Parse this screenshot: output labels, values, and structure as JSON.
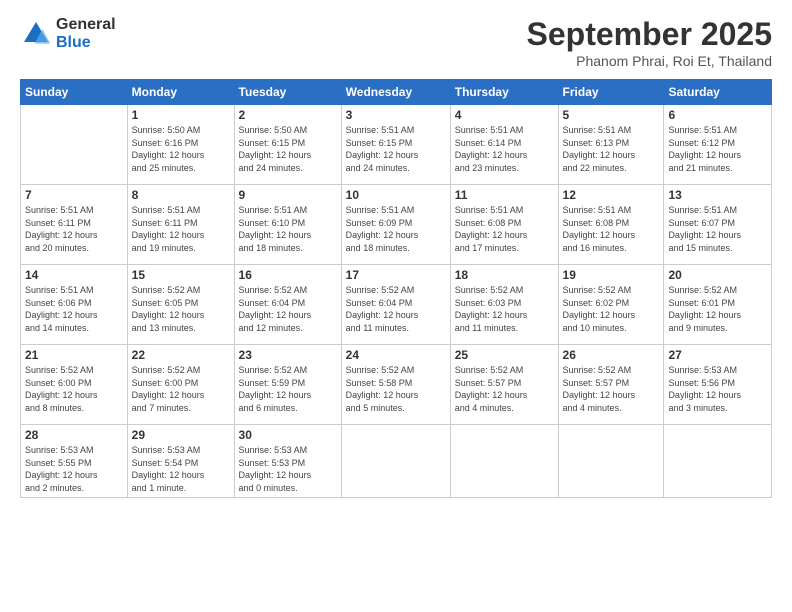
{
  "logo": {
    "general": "General",
    "blue": "Blue"
  },
  "header": {
    "month": "September 2025",
    "location": "Phanom Phrai, Roi Et, Thailand"
  },
  "weekdays": [
    "Sunday",
    "Monday",
    "Tuesday",
    "Wednesday",
    "Thursday",
    "Friday",
    "Saturday"
  ],
  "weeks": [
    [
      {
        "day": "",
        "info": ""
      },
      {
        "day": "1",
        "info": "Sunrise: 5:50 AM\nSunset: 6:16 PM\nDaylight: 12 hours\nand 25 minutes."
      },
      {
        "day": "2",
        "info": "Sunrise: 5:50 AM\nSunset: 6:15 PM\nDaylight: 12 hours\nand 24 minutes."
      },
      {
        "day": "3",
        "info": "Sunrise: 5:51 AM\nSunset: 6:15 PM\nDaylight: 12 hours\nand 24 minutes."
      },
      {
        "day": "4",
        "info": "Sunrise: 5:51 AM\nSunset: 6:14 PM\nDaylight: 12 hours\nand 23 minutes."
      },
      {
        "day": "5",
        "info": "Sunrise: 5:51 AM\nSunset: 6:13 PM\nDaylight: 12 hours\nand 22 minutes."
      },
      {
        "day": "6",
        "info": "Sunrise: 5:51 AM\nSunset: 6:12 PM\nDaylight: 12 hours\nand 21 minutes."
      }
    ],
    [
      {
        "day": "7",
        "info": "Sunrise: 5:51 AM\nSunset: 6:11 PM\nDaylight: 12 hours\nand 20 minutes."
      },
      {
        "day": "8",
        "info": "Sunrise: 5:51 AM\nSunset: 6:11 PM\nDaylight: 12 hours\nand 19 minutes."
      },
      {
        "day": "9",
        "info": "Sunrise: 5:51 AM\nSunset: 6:10 PM\nDaylight: 12 hours\nand 18 minutes."
      },
      {
        "day": "10",
        "info": "Sunrise: 5:51 AM\nSunset: 6:09 PM\nDaylight: 12 hours\nand 18 minutes."
      },
      {
        "day": "11",
        "info": "Sunrise: 5:51 AM\nSunset: 6:08 PM\nDaylight: 12 hours\nand 17 minutes."
      },
      {
        "day": "12",
        "info": "Sunrise: 5:51 AM\nSunset: 6:08 PM\nDaylight: 12 hours\nand 16 minutes."
      },
      {
        "day": "13",
        "info": "Sunrise: 5:51 AM\nSunset: 6:07 PM\nDaylight: 12 hours\nand 15 minutes."
      }
    ],
    [
      {
        "day": "14",
        "info": "Sunrise: 5:51 AM\nSunset: 6:06 PM\nDaylight: 12 hours\nand 14 minutes."
      },
      {
        "day": "15",
        "info": "Sunrise: 5:52 AM\nSunset: 6:05 PM\nDaylight: 12 hours\nand 13 minutes."
      },
      {
        "day": "16",
        "info": "Sunrise: 5:52 AM\nSunset: 6:04 PM\nDaylight: 12 hours\nand 12 minutes."
      },
      {
        "day": "17",
        "info": "Sunrise: 5:52 AM\nSunset: 6:04 PM\nDaylight: 12 hours\nand 11 minutes."
      },
      {
        "day": "18",
        "info": "Sunrise: 5:52 AM\nSunset: 6:03 PM\nDaylight: 12 hours\nand 11 minutes."
      },
      {
        "day": "19",
        "info": "Sunrise: 5:52 AM\nSunset: 6:02 PM\nDaylight: 12 hours\nand 10 minutes."
      },
      {
        "day": "20",
        "info": "Sunrise: 5:52 AM\nSunset: 6:01 PM\nDaylight: 12 hours\nand 9 minutes."
      }
    ],
    [
      {
        "day": "21",
        "info": "Sunrise: 5:52 AM\nSunset: 6:00 PM\nDaylight: 12 hours\nand 8 minutes."
      },
      {
        "day": "22",
        "info": "Sunrise: 5:52 AM\nSunset: 6:00 PM\nDaylight: 12 hours\nand 7 minutes."
      },
      {
        "day": "23",
        "info": "Sunrise: 5:52 AM\nSunset: 5:59 PM\nDaylight: 12 hours\nand 6 minutes."
      },
      {
        "day": "24",
        "info": "Sunrise: 5:52 AM\nSunset: 5:58 PM\nDaylight: 12 hours\nand 5 minutes."
      },
      {
        "day": "25",
        "info": "Sunrise: 5:52 AM\nSunset: 5:57 PM\nDaylight: 12 hours\nand 4 minutes."
      },
      {
        "day": "26",
        "info": "Sunrise: 5:52 AM\nSunset: 5:57 PM\nDaylight: 12 hours\nand 4 minutes."
      },
      {
        "day": "27",
        "info": "Sunrise: 5:53 AM\nSunset: 5:56 PM\nDaylight: 12 hours\nand 3 minutes."
      }
    ],
    [
      {
        "day": "28",
        "info": "Sunrise: 5:53 AM\nSunset: 5:55 PM\nDaylight: 12 hours\nand 2 minutes."
      },
      {
        "day": "29",
        "info": "Sunrise: 5:53 AM\nSunset: 5:54 PM\nDaylight: 12 hours\nand 1 minute."
      },
      {
        "day": "30",
        "info": "Sunrise: 5:53 AM\nSunset: 5:53 PM\nDaylight: 12 hours\nand 0 minutes."
      },
      {
        "day": "",
        "info": ""
      },
      {
        "day": "",
        "info": ""
      },
      {
        "day": "",
        "info": ""
      },
      {
        "day": "",
        "info": ""
      }
    ]
  ]
}
